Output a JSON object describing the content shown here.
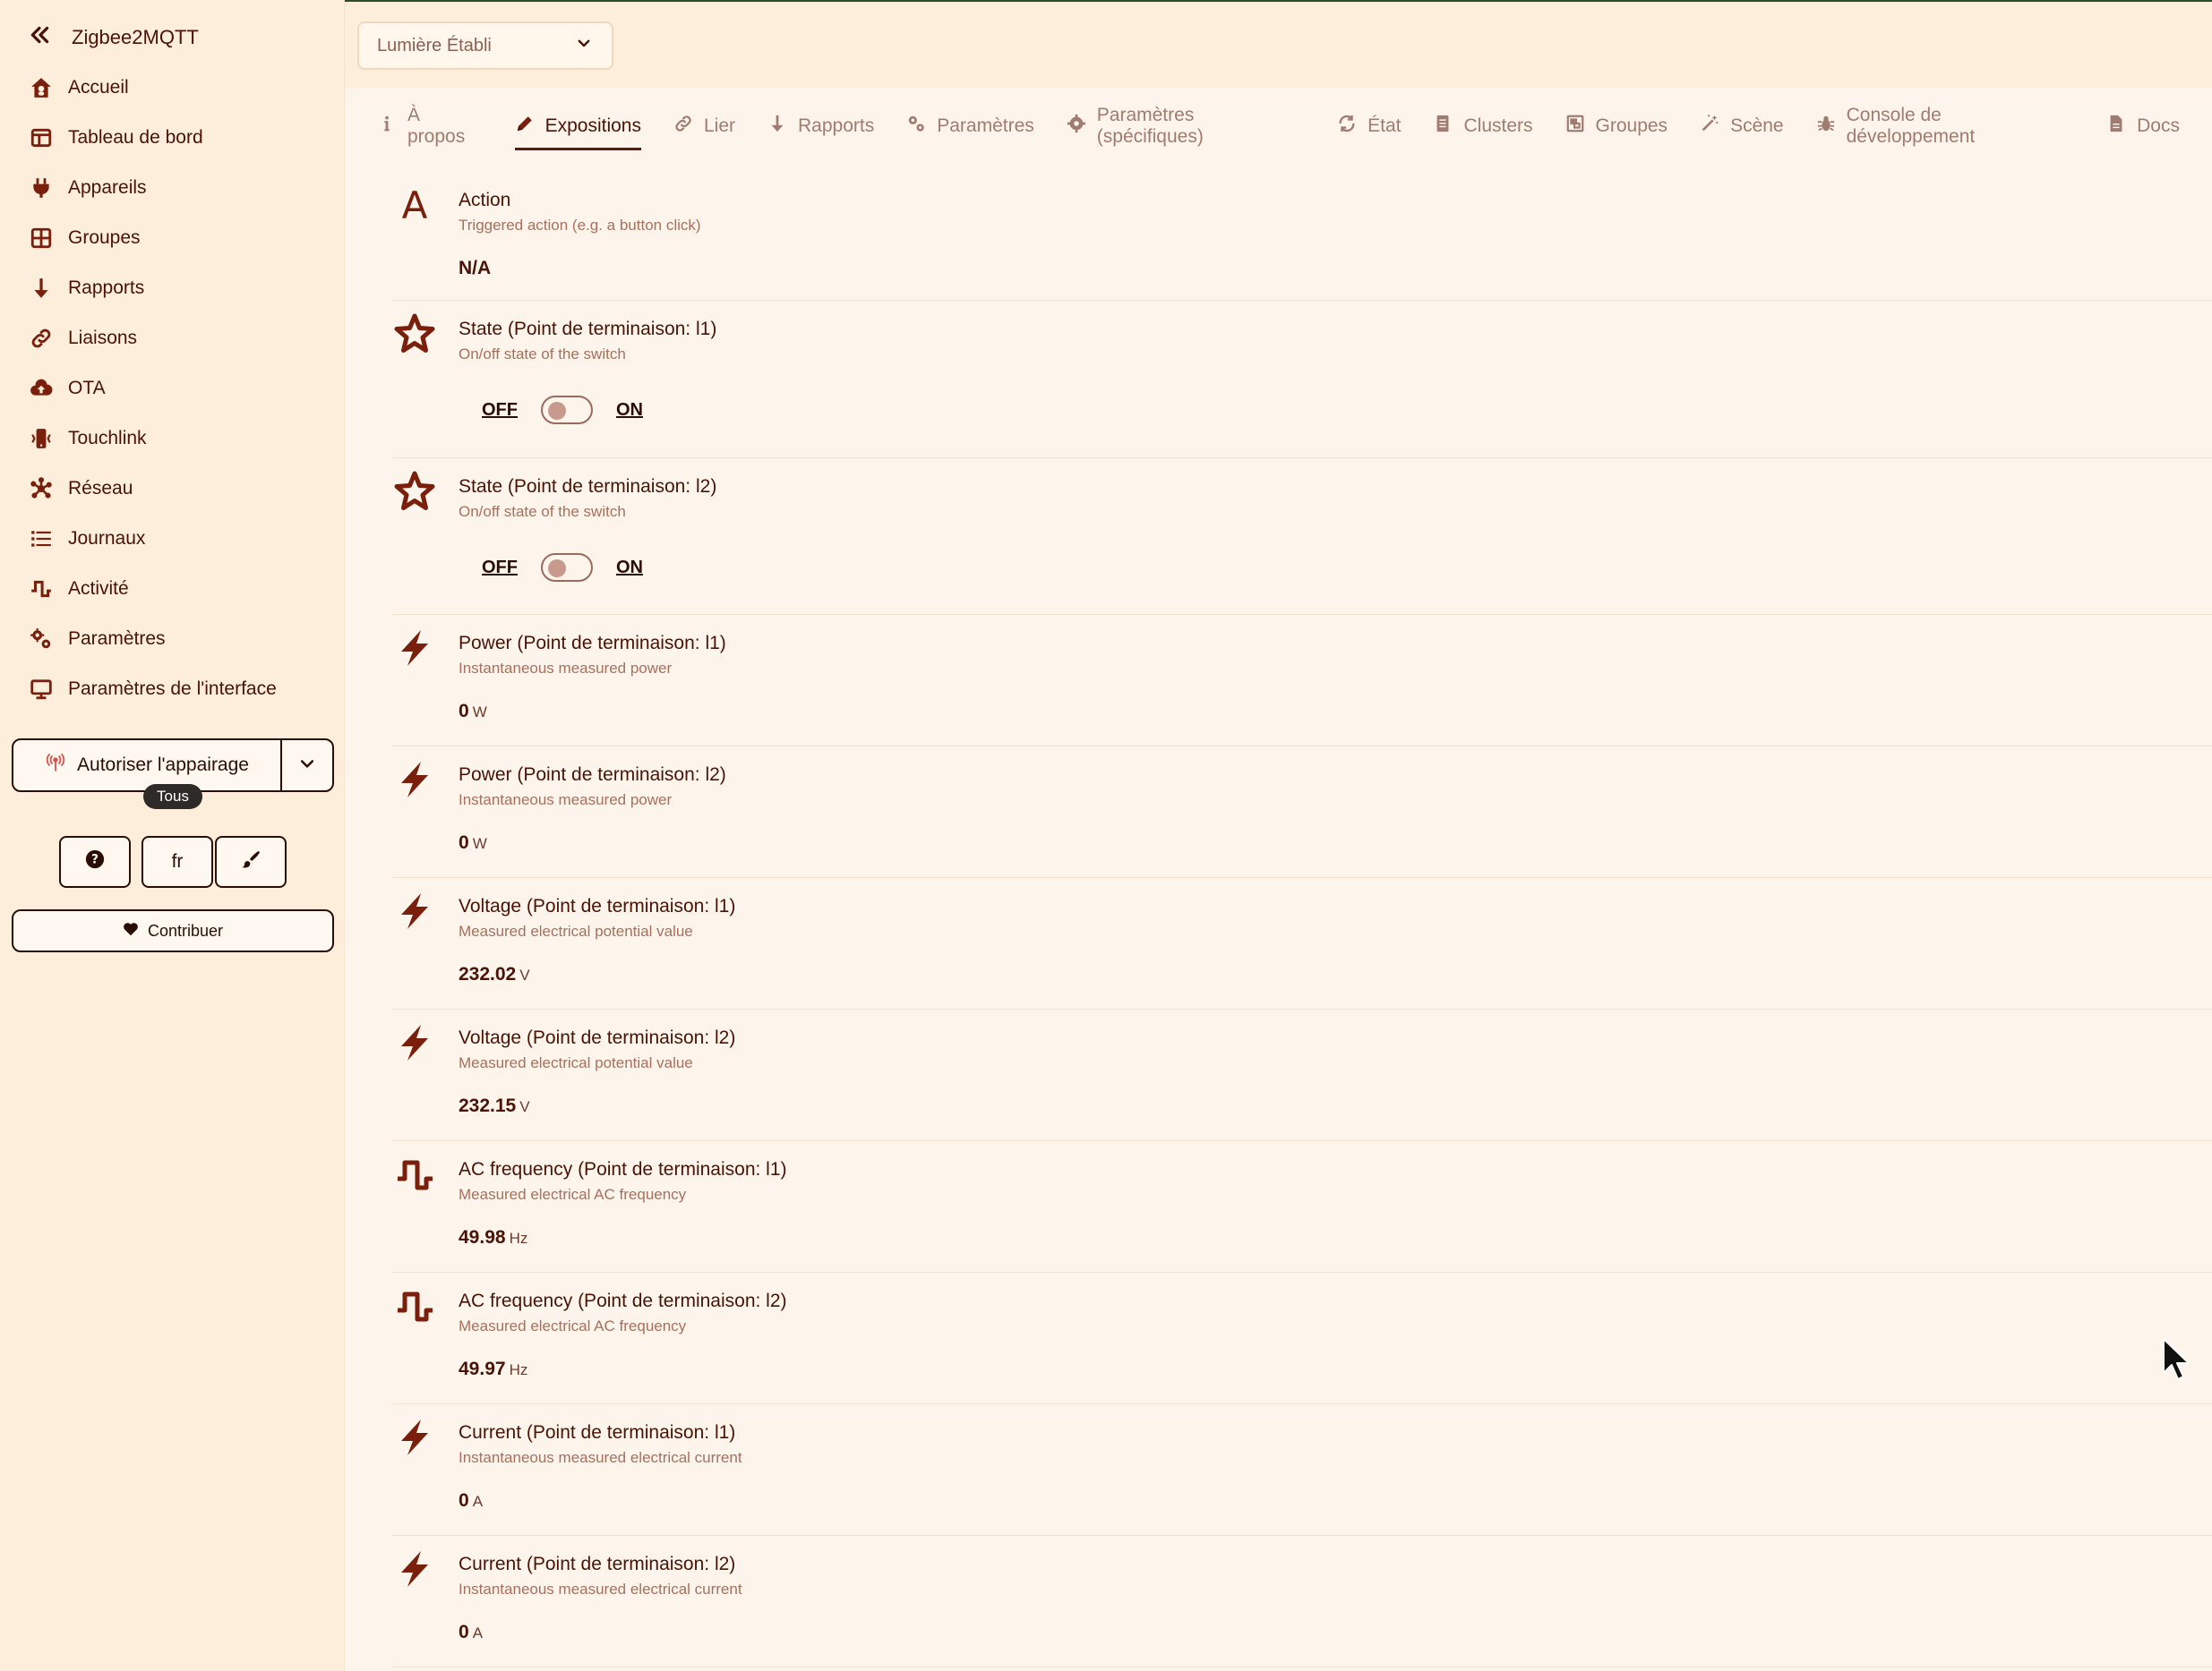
{
  "sidebar": {
    "brand": "Zigbee2MQTT",
    "items": [
      {
        "label": "Accueil",
        "icon": "home-icon"
      },
      {
        "label": "Tableau de bord",
        "icon": "dashboard-icon"
      },
      {
        "label": "Appareils",
        "icon": "plug-icon"
      },
      {
        "label": "Groupes",
        "icon": "grid-icon"
      },
      {
        "label": "Rapports",
        "icon": "arrow-down-icon"
      },
      {
        "label": "Liaisons",
        "icon": "link-icon"
      },
      {
        "label": "OTA",
        "icon": "cloud-upload-icon"
      },
      {
        "label": "Touchlink",
        "icon": "mobile-icon"
      },
      {
        "label": "Réseau",
        "icon": "network-icon"
      },
      {
        "label": "Journaux",
        "icon": "list-icon"
      },
      {
        "label": "Activité",
        "icon": "wave-icon"
      },
      {
        "label": "Paramètres",
        "icon": "gears-icon"
      },
      {
        "label": "Paramètres de l'interface",
        "icon": "monitor-icon"
      }
    ],
    "permit_join_label": "Autoriser l'appairage",
    "permit_join_badge": "Tous",
    "language_label": "fr",
    "contribute_label": "Contribuer"
  },
  "header": {
    "device_selected": "Lumière Établi"
  },
  "tabs": [
    {
      "label": "À propos",
      "icon": "info-icon",
      "active": false
    },
    {
      "label": "Expositions",
      "icon": "pencil-icon",
      "active": true
    },
    {
      "label": "Lier",
      "icon": "link-icon",
      "active": false
    },
    {
      "label": "Rapports",
      "icon": "arrow-down-icon",
      "active": false
    },
    {
      "label": "Paramètres",
      "icon": "gears-icon",
      "active": false
    },
    {
      "label": "Paramètres (spécifiques)",
      "icon": "gear-icon",
      "active": false
    },
    {
      "label": "État",
      "icon": "refresh-icon",
      "active": false
    },
    {
      "label": "Clusters",
      "icon": "document-icon",
      "active": false
    },
    {
      "label": "Groupes",
      "icon": "group-icon",
      "active": false
    },
    {
      "label": "Scène",
      "icon": "wand-icon",
      "active": false
    },
    {
      "label": "Console de développement",
      "icon": "bug-icon",
      "active": false
    },
    {
      "label": "Docs",
      "icon": "file-icon",
      "active": false
    }
  ],
  "exposes": [
    {
      "name": "Action",
      "desc": "Triggered action (e.g. a button click)",
      "icon": "letter-a-icon",
      "kind": "value",
      "value": "N/A",
      "unit": ""
    },
    {
      "name": "State (Point de terminaison: l1)",
      "desc": "On/off state of the switch",
      "icon": "star-icon",
      "kind": "toggle",
      "off_label": "OFF",
      "on_label": "ON"
    },
    {
      "name": "State (Point de terminaison: l2)",
      "desc": "On/off state of the switch",
      "icon": "star-icon",
      "kind": "toggle",
      "off_label": "OFF",
      "on_label": "ON"
    },
    {
      "name": "Power (Point de terminaison: l1)",
      "desc": "Instantaneous measured power",
      "icon": "bolt-icon",
      "kind": "value",
      "value": "0",
      "unit": "W"
    },
    {
      "name": "Power (Point de terminaison: l2)",
      "desc": "Instantaneous measured power",
      "icon": "bolt-icon",
      "kind": "value",
      "value": "0",
      "unit": "W"
    },
    {
      "name": "Voltage (Point de terminaison: l1)",
      "desc": "Measured electrical potential value",
      "icon": "bolt-icon",
      "kind": "value",
      "value": "232.02",
      "unit": "V"
    },
    {
      "name": "Voltage (Point de terminaison: l2)",
      "desc": "Measured electrical potential value",
      "icon": "bolt-icon",
      "kind": "value",
      "value": "232.15",
      "unit": "V"
    },
    {
      "name": "AC frequency (Point de terminaison: l1)",
      "desc": "Measured electrical AC frequency",
      "icon": "wave-icon",
      "kind": "value",
      "value": "49.98",
      "unit": "Hz"
    },
    {
      "name": "AC frequency (Point de terminaison: l2)",
      "desc": "Measured electrical AC frequency",
      "icon": "wave-icon",
      "kind": "value",
      "value": "49.97",
      "unit": "Hz"
    },
    {
      "name": "Current (Point de terminaison: l1)",
      "desc": "Instantaneous measured electrical current",
      "icon": "bolt-icon",
      "kind": "value",
      "value": "0",
      "unit": "A"
    },
    {
      "name": "Current (Point de terminaison: l2)",
      "desc": "Instantaneous measured electrical current",
      "icon": "bolt-icon",
      "kind": "value",
      "value": "0",
      "unit": "A"
    }
  ]
}
